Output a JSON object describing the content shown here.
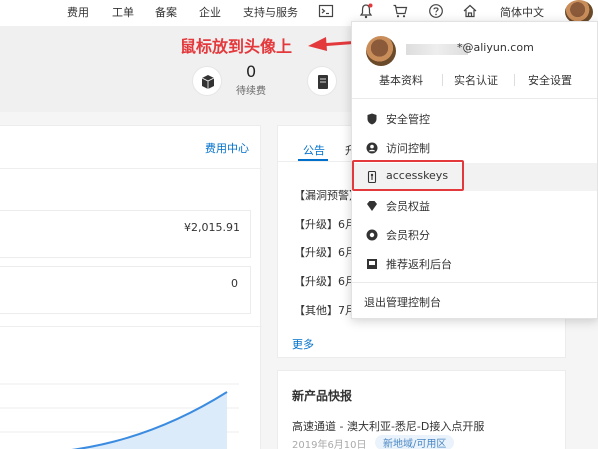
{
  "topbar": {
    "nav": [
      "费用",
      "工单",
      "备案",
      "企业",
      "支持与服务"
    ],
    "language": "简体中文",
    "icons": [
      "terminal-icon",
      "bell-icon",
      "cart-icon",
      "help-icon",
      "home-icon"
    ]
  },
  "annotation": {
    "text": "鼠标放到头像上",
    "color": "#e4393c"
  },
  "stats": {
    "count": "0",
    "label": "待续费"
  },
  "billing": {
    "title": "费用中心",
    "amount": "¥2,015.91",
    "second_value": "0"
  },
  "notices": {
    "tab_active": "公告",
    "tab_partial": "升",
    "items": [
      "【漏洞预警】",
      "【升级】6月",
      "【升级】6月",
      "【升级】6月",
      "【其他】7月"
    ],
    "more": "更多"
  },
  "news": {
    "title": "新产品快报",
    "headline": "高速通道 - 澳大利亚-悉尼-D接入点开服",
    "date": "2019年6月10日",
    "tag": "新地域/可用区"
  },
  "account_menu": {
    "email": "*@aliyun.com",
    "links": [
      "基本资料",
      "实名认证",
      "安全设置"
    ],
    "items": [
      {
        "label": "安全管控",
        "icon": "shield-icon"
      },
      {
        "label": "访问控制",
        "icon": "user-circle-icon"
      },
      {
        "label": "accesskeys",
        "icon": "key-icon"
      },
      {
        "label": "会员权益",
        "icon": "diamond-icon"
      },
      {
        "label": "会员积分",
        "icon": "points-icon"
      },
      {
        "label": "推荐返利后台",
        "icon": "gift-icon"
      }
    ],
    "logout": "退出管理控制台",
    "highlighted": "accesskeys"
  },
  "colors": {
    "accent": "#0070cc",
    "annotation_red": "#e4393c"
  }
}
